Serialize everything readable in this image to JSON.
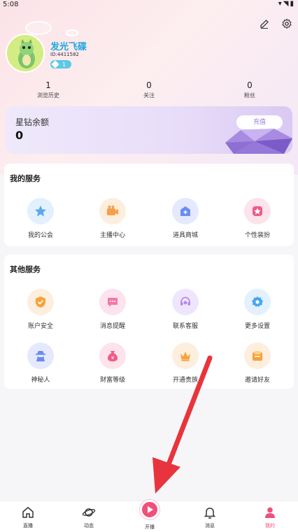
{
  "status_bar": {
    "time": "5:08"
  },
  "profile": {
    "username": "发光飞碟",
    "user_id": "ID:4411582",
    "level": "1"
  },
  "stats": [
    {
      "value": "1",
      "label": "浏览历史"
    },
    {
      "value": "0",
      "label": "关注"
    },
    {
      "value": "0",
      "label": "粉丝"
    }
  ],
  "balance": {
    "title": "星钻余额",
    "amount": "0",
    "recharge_label": "充值"
  },
  "my_services": {
    "title": "我的服务",
    "items": [
      {
        "label": "我的公会",
        "icon": "guild-star-icon",
        "color": "#5aa8f0"
      },
      {
        "label": "主播中心",
        "icon": "camera-icon",
        "color": "#f6a04a"
      },
      {
        "label": "道具商城",
        "icon": "shop-icon",
        "color": "#6b8cf2"
      },
      {
        "label": "个性装扮",
        "icon": "decor-star-icon",
        "color": "#f05b86"
      }
    ]
  },
  "other_services": {
    "title": "其他服务",
    "items": [
      {
        "label": "账户安全",
        "icon": "shield-icon",
        "color": "#f5a33b"
      },
      {
        "label": "消息提醒",
        "icon": "chat-icon",
        "color": "#f578a7"
      },
      {
        "label": "联系客服",
        "icon": "headset-icon",
        "color": "#b48af0"
      },
      {
        "label": "更多设置",
        "icon": "gear-icon",
        "color": "#46a6f0"
      },
      {
        "label": "神秘人",
        "icon": "mystery-icon",
        "color": "#6d8af0"
      },
      {
        "label": "财富等级",
        "icon": "money-bag-icon",
        "color": "#f05b86"
      },
      {
        "label": "开通贵族",
        "icon": "crown-icon",
        "color": "#f5a33b"
      },
      {
        "label": "邀请好友",
        "icon": "gift-icon",
        "color": "#f5a33b"
      }
    ]
  },
  "bottom_nav": [
    {
      "label": "直播",
      "icon": "home-icon"
    },
    {
      "label": "动态",
      "icon": "planet-icon"
    },
    {
      "label": "开播",
      "icon": "play-icon"
    },
    {
      "label": "消息",
      "icon": "bell-icon"
    },
    {
      "label": "我的",
      "icon": "person-icon"
    }
  ],
  "colors": {
    "accent": "#f04f7a",
    "annotation_arrow": "#e8343c"
  }
}
